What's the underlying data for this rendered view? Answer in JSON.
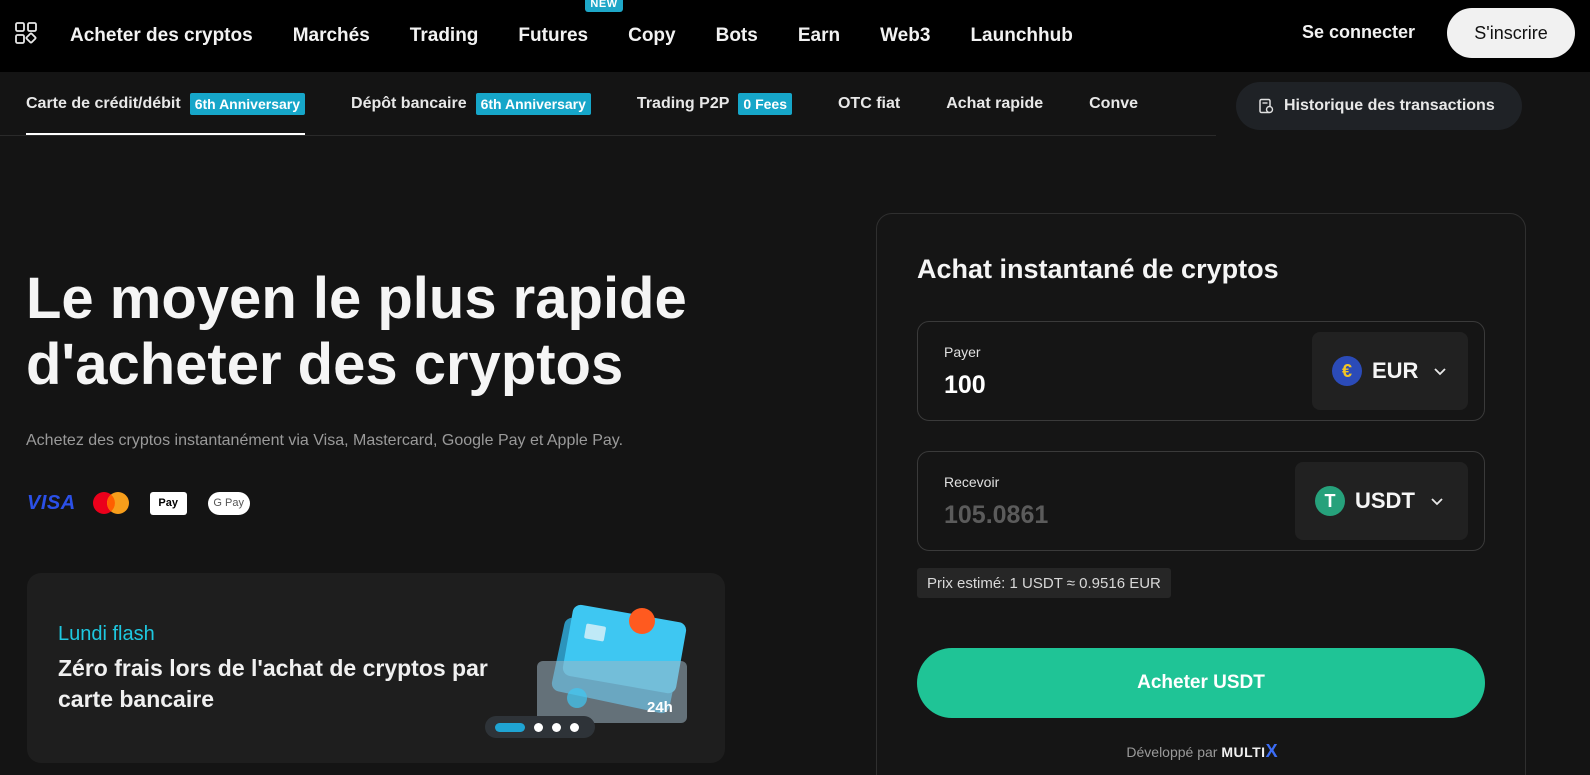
{
  "topnav": {
    "items": [
      "Acheter des cryptos",
      "Marchés",
      "Trading",
      "Futures",
      "Copy",
      "Bots",
      "Earn",
      "Web3",
      "Launchhub"
    ],
    "futures_badge": "NEW",
    "login": "Se connecter",
    "signup": "S'inscrire"
  },
  "subnav": {
    "tabs": [
      {
        "label": "Carte de crédit/débit",
        "badge": "6th Anniversary"
      },
      {
        "label": "Dépôt bancaire",
        "badge": "6th Anniversary"
      },
      {
        "label": "Trading P2P",
        "badge": "0 Fees"
      },
      {
        "label": "OTC fiat"
      },
      {
        "label": "Achat rapide"
      },
      {
        "label": "Conve"
      }
    ],
    "history": "Historique des transactions"
  },
  "hero": {
    "title_line1": "Le moyen le plus rapide",
    "title_line2": "d'acheter des cryptos",
    "subtitle": "Achetez des cryptos instantanément via Visa, Mastercard, Google Pay et Apple Pay.",
    "payment_methods": {
      "visa": "VISA",
      "apple_pay": "Pay",
      "google_pay": "G Pay"
    }
  },
  "promo": {
    "tag": "Lundi flash",
    "text": "Zéro frais lors de l'achat de cryptos par carte bancaire",
    "art_label": "24h",
    "slides_total": 4,
    "active_slide": 1
  },
  "widget": {
    "title": "Achat instantané de cryptos",
    "pay": {
      "label": "Payer",
      "value": "100",
      "currency": "EUR",
      "currency_symbol": "€"
    },
    "receive": {
      "label": "Recevoir",
      "value": "105.0861",
      "currency": "USDT",
      "currency_symbol": "T"
    },
    "estimate": "Prix estimé: 1 USDT ≈ 0.9516 EUR",
    "buy_button": "Acheter USDT",
    "powered_by": "Développé par",
    "powered_brand": "MULTI",
    "powered_x": "X"
  },
  "colors": {
    "accent_green": "#1fc496",
    "badge_cyan": "#16a6c9",
    "promo_tag": "#1ec8e0",
    "background": "#141414"
  }
}
